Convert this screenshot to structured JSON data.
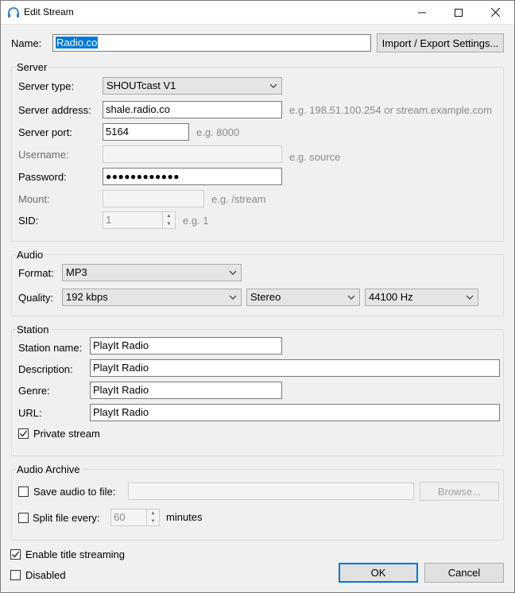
{
  "window": {
    "title": "Edit Stream",
    "minimize_icon": "minimize-icon",
    "maximize_icon": "maximize-icon",
    "close_icon": "close-icon"
  },
  "name": {
    "label": "Name:",
    "value": "Radio.co",
    "import_export_button": "Import / Export Settings..."
  },
  "server": {
    "group_title": "Server",
    "type_label": "Server type:",
    "type_value": "SHOUTcast V1",
    "address_label": "Server address:",
    "address_value": "shale.radio.co",
    "address_hint": "e.g. 198.51.100.254 or stream.example.com",
    "port_label": "Server port:",
    "port_value": "5164",
    "port_hint": "e.g. 8000",
    "username_label": "Username:",
    "username_value": "",
    "username_hint": "e.g. source",
    "password_label": "Password:",
    "password_value": "●●●●●●●●●●●●",
    "mount_label": "Mount:",
    "mount_value": "",
    "mount_hint": "e.g. /stream",
    "sid_label": "SID:",
    "sid_value": "1",
    "sid_hint": "e.g. 1"
  },
  "audio": {
    "group_title": "Audio",
    "format_label": "Format:",
    "format_value": "MP3",
    "quality_label": "Quality:",
    "bitrate_value": "192 kbps",
    "channels_value": "Stereo",
    "samplerate_value": "44100 Hz"
  },
  "station": {
    "group_title": "Station",
    "name_label": "Station name:",
    "name_value": "PlayIt Radio",
    "description_label": "Description:",
    "description_value": "PlayIt Radio",
    "genre_label": "Genre:",
    "genre_value": "PlayIt Radio",
    "url_label": "URL:",
    "url_value": "PlayIt Radio",
    "private_label": "Private stream",
    "private_checked": true
  },
  "archive": {
    "group_title": "Audio Archive",
    "save_label": "Save audio to file:",
    "save_checked": false,
    "save_path": "",
    "browse_button": "Browse...",
    "split_label": "Split file every:",
    "split_checked": false,
    "split_value": "60",
    "split_unit": "minutes"
  },
  "footer": {
    "title_streaming_label": "Enable title streaming",
    "title_streaming_checked": true,
    "disabled_label": "Disabled",
    "disabled_checked": false,
    "ok_button": "OK",
    "cancel_button": "Cancel"
  },
  "colors": {
    "accent": "#0078d7",
    "hint_text": "#8a8a8a",
    "window_bg": "#f0f0f0"
  }
}
